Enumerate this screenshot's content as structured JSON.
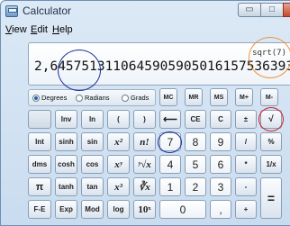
{
  "window": {
    "title": "Calculator",
    "controls": {
      "minimize": "▭",
      "maximize": "□",
      "close": "✕"
    }
  },
  "menu": {
    "view": {
      "underline": "V",
      "rest": "iew"
    },
    "edit": {
      "underline": "E",
      "rest": "dit"
    },
    "help": {
      "underline": "H",
      "rest": "elp"
    }
  },
  "display": {
    "expression": "sqrt(7)",
    "result": "2,6457513110645905905016157536393"
  },
  "angle_mode": {
    "options": [
      "Degrees",
      "Radians",
      "Grads"
    ],
    "selected": "Degrees"
  },
  "keys": {
    "mc": "MC",
    "mr": "MR",
    "ms": "MS",
    "mplus": "M+",
    "mminus": "M-",
    "inv": "Inv",
    "ln": "ln",
    "lparen": "(",
    "rparen": ")",
    "backspace": "⟵",
    "ce": "CE",
    "c": "C",
    "plusminus": "±",
    "sqrt": "√",
    "int": "Int",
    "sinh": "sinh",
    "sin": "sin",
    "x2": "x²",
    "nfact": "n!",
    "d7": "7",
    "d8": "8",
    "d9": "9",
    "divide": "/",
    "percent": "%",
    "dms": "dms",
    "cosh": "cosh",
    "cos": "cos",
    "xy": "xʸ",
    "yroot": "ʸ√x",
    "d4": "4",
    "d5": "5",
    "d6": "6",
    "multiply": "*",
    "reciprocal": "1/x",
    "pi": "π",
    "tanh": "tanh",
    "tan": "tan",
    "x3": "x³",
    "cuberoot": "∛x",
    "d1": "1",
    "d2": "2",
    "d3": "3",
    "minus": "-",
    "equals": "=",
    "fe": "F-E",
    "exp": "Exp",
    "mod": "Mod",
    "log": "log",
    "ten_x": "10ˣ",
    "d0": "0",
    "decimal": ",",
    "plus": "+"
  }
}
